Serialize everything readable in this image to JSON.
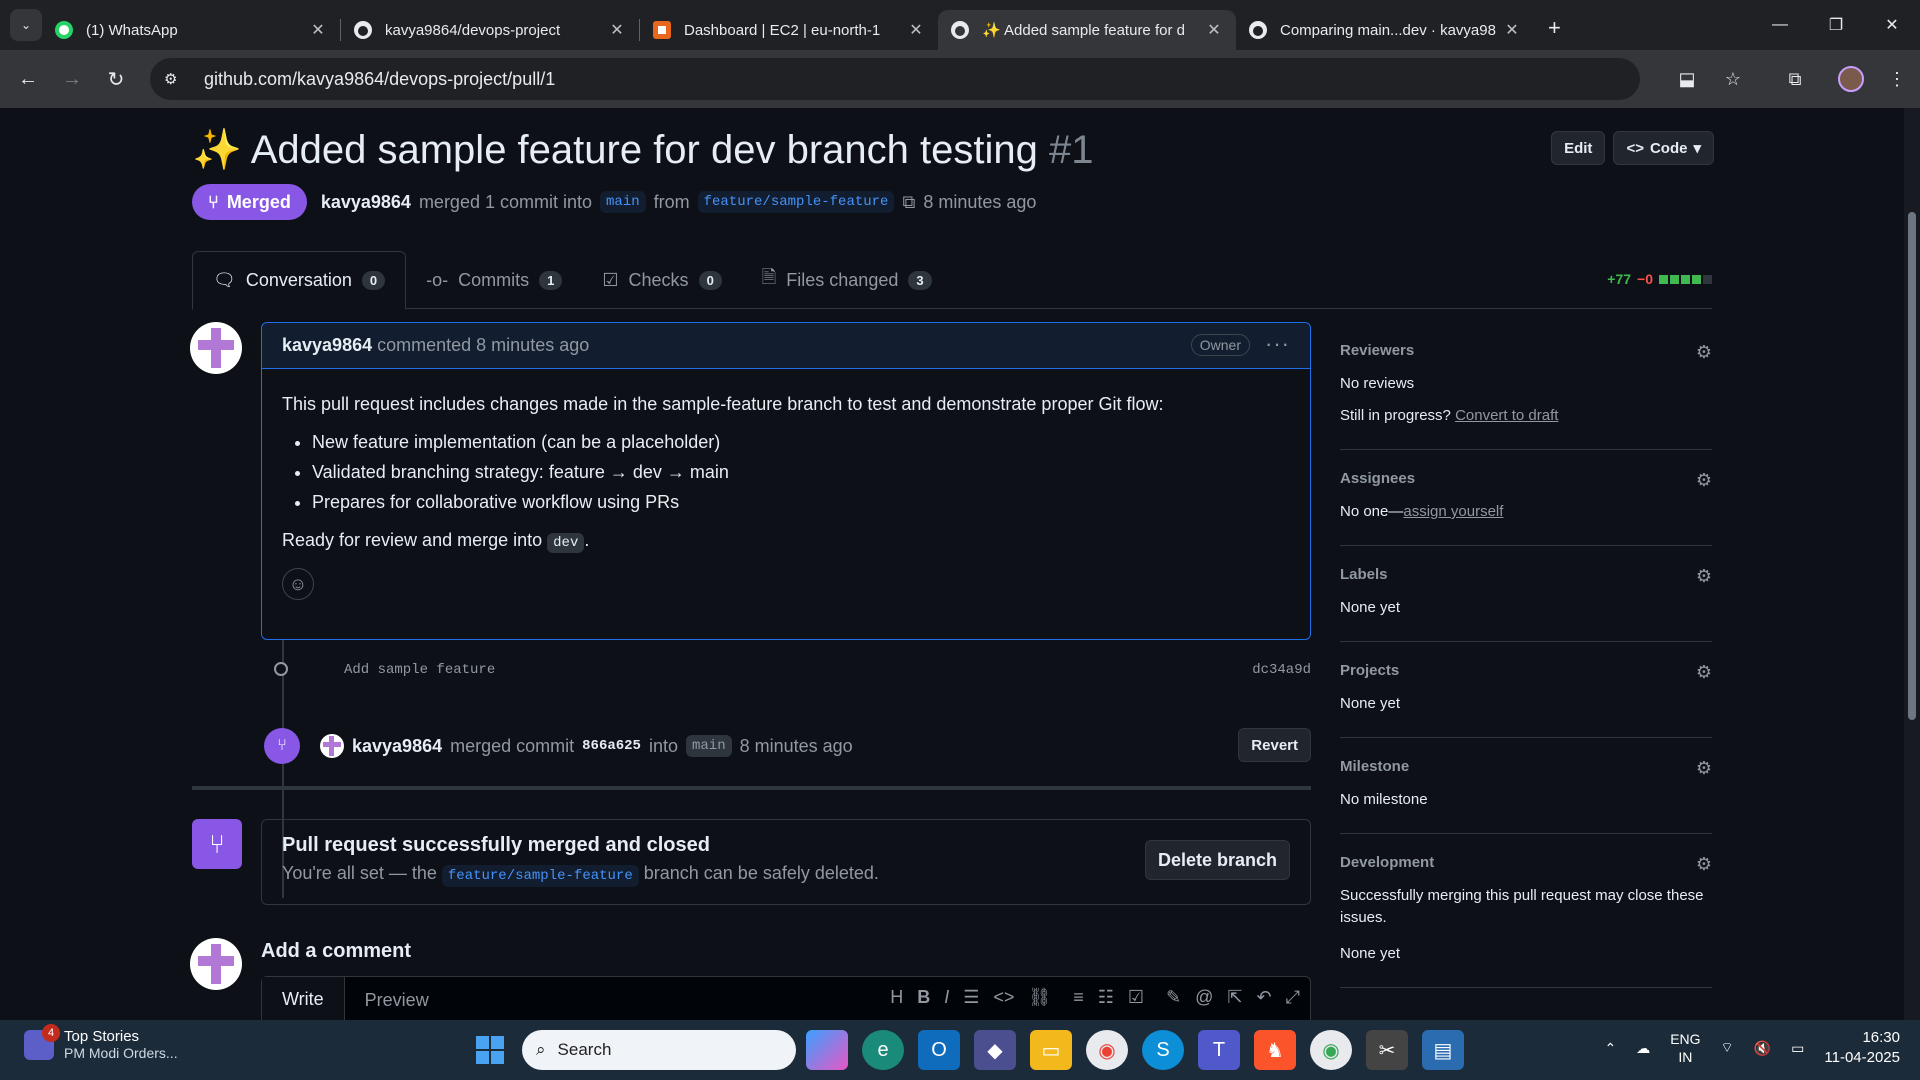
{
  "browser": {
    "tabs": [
      {
        "title": "(1) WhatsApp",
        "icon": "whatsapp-icon",
        "active": false
      },
      {
        "title": "kavya9864/devops-project",
        "icon": "github-icon",
        "active": false
      },
      {
        "title": "Dashboard | EC2 | eu-north-1",
        "icon": "aws-icon",
        "active": false
      },
      {
        "title": "✨ Added sample feature for d",
        "icon": "github-icon",
        "active": true
      },
      {
        "title": "Comparing main...dev · kavya98",
        "icon": "github-icon",
        "active": false
      }
    ],
    "url": "github.com/kavya9864/devops-project/pull/1"
  },
  "pr": {
    "title": "✨ Added sample feature for dev branch testing",
    "number": "#1",
    "edit_label": "Edit",
    "code_label": "Code",
    "state": "Merged",
    "author": "kavya9864",
    "merged_text": "merged 1 commit into",
    "base_branch": "main",
    "from_text": "from",
    "head_branch": "feature/sample-feature",
    "time": "8 minutes ago",
    "tabs": [
      {
        "label": "Conversation",
        "count": "0"
      },
      {
        "label": "Commits",
        "count": "1"
      },
      {
        "label": "Checks",
        "count": "0"
      },
      {
        "label": "Files changed",
        "count": "3"
      }
    ],
    "additions": "+77",
    "deletions": "−0"
  },
  "comment": {
    "author": "kavya9864",
    "action": "commented 8 minutes ago",
    "role": "Owner",
    "intro": "This pull request includes changes made in the sample-feature branch to test and demonstrate proper Git flow:",
    "bullets": [
      "New feature implementation (can be a placeholder)",
      "Validated branching strategy: feature → dev → main",
      "Prepares for collaborative workflow using PRs"
    ],
    "outro_prefix": "Ready for review and merge into",
    "outro_code": "dev",
    "outro_suffix": "."
  },
  "commit": {
    "message": "Add sample feature",
    "sha": "dc34a9d"
  },
  "merge_event": {
    "author": "kavya9864",
    "text": "merged commit",
    "sha": "866a625",
    "into": "into",
    "branch": "main",
    "time": "8 minutes ago",
    "revert_label": "Revert"
  },
  "merged_box": {
    "title": "Pull request successfully merged and closed",
    "sub_prefix": "You're all set — the",
    "branch": "feature/sample-feature",
    "sub_suffix": "branch can be safely deleted.",
    "delete_label": "Delete branch"
  },
  "add_comment": {
    "title": "Add a comment",
    "write_tab": "Write",
    "preview_tab": "Preview"
  },
  "sidebar": {
    "reviewers": {
      "heading": "Reviewers",
      "value": "No reviews",
      "progress_prefix": "Still in progress?",
      "progress_link": "Convert to draft"
    },
    "assignees": {
      "heading": "Assignees",
      "value_prefix": "No one—",
      "value_link": "assign yourself"
    },
    "labels": {
      "heading": "Labels",
      "value": "None yet"
    },
    "projects": {
      "heading": "Projects",
      "value": "None yet"
    },
    "milestone": {
      "heading": "Milestone",
      "value": "No milestone"
    },
    "development": {
      "heading": "Development",
      "desc": "Successfully merging this pull request may close these issues.",
      "value": "None yet"
    }
  },
  "taskbar": {
    "news_title": "Top Stories",
    "news_sub": "PM Modi Orders...",
    "news_badge": "4",
    "search_placeholder": "Search",
    "lang_top": "ENG",
    "lang_bottom": "IN",
    "time": "16:30",
    "date": "11-04-2025"
  },
  "colors": {
    "merged": "#8957e5",
    "link": "#4493f8",
    "add": "#3fb950",
    "del": "#f85149"
  }
}
